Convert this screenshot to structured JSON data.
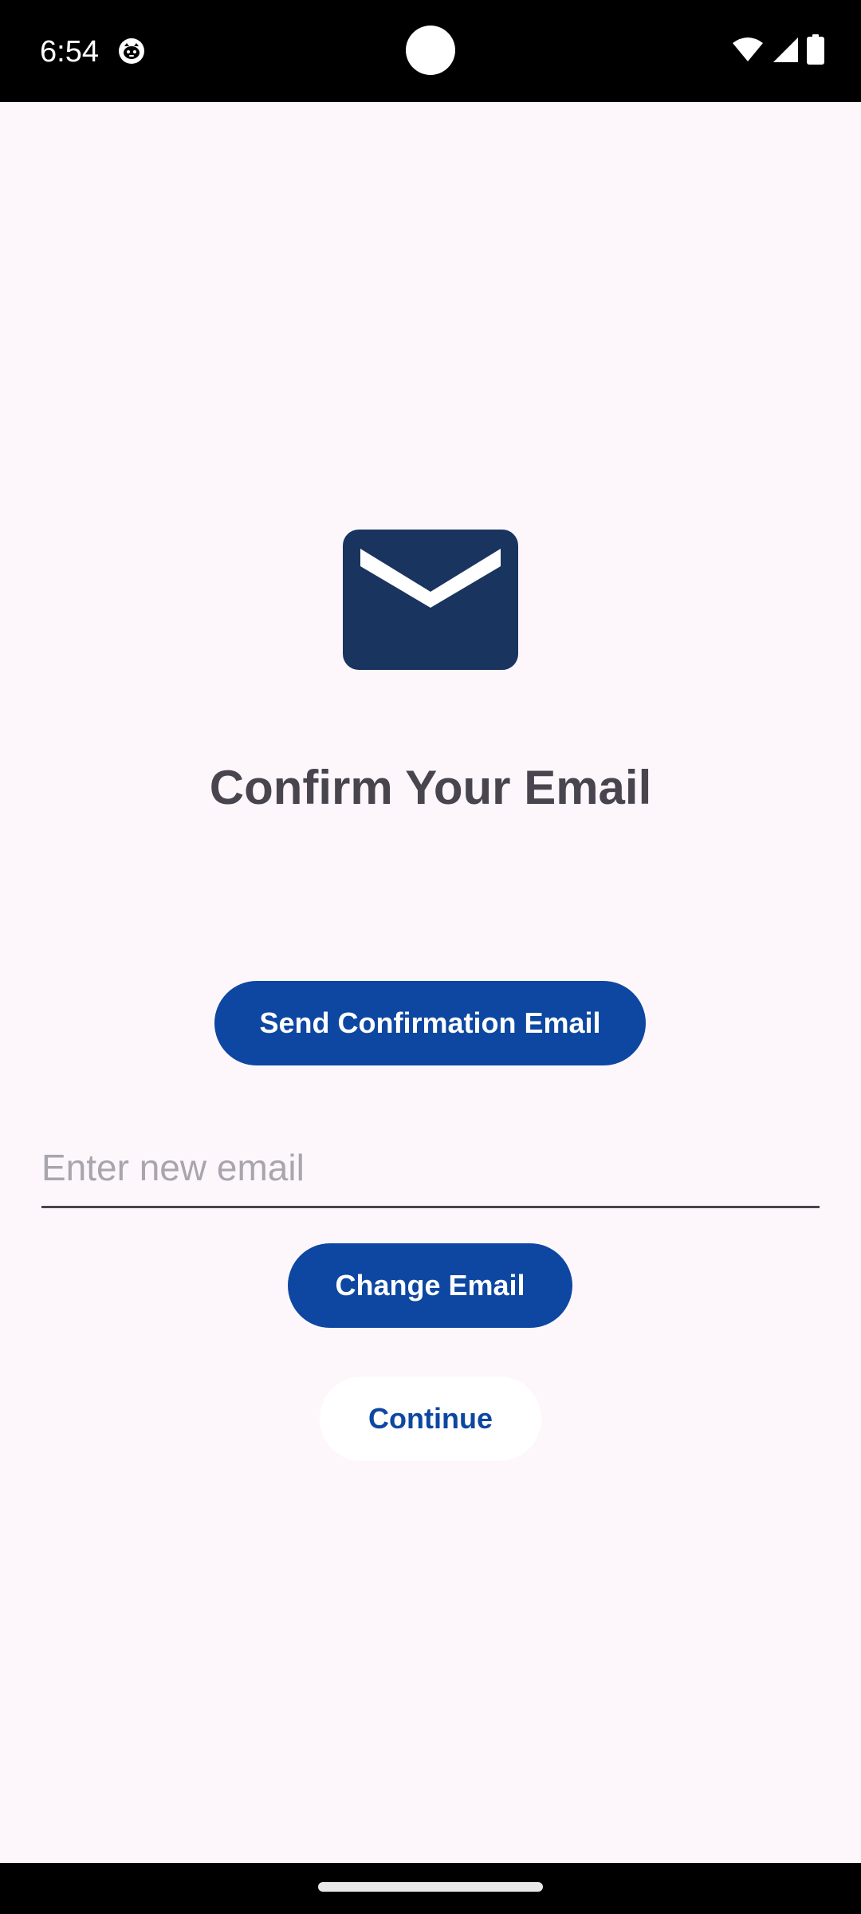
{
  "status_bar": {
    "time": "6:54",
    "app_icon": "cat-face-icon",
    "icons": [
      "wifi-icon",
      "cellular-signal-icon",
      "battery-icon"
    ]
  },
  "illustration": {
    "icon": "email-envelope-icon",
    "color": "#1a3460"
  },
  "main": {
    "title": "Confirm Your Email",
    "send_button_label": "Send Confirmation Email",
    "email_input": {
      "value": "",
      "placeholder": "Enter new email"
    },
    "change_button_label": "Change Email",
    "continue_button_label": "Continue"
  },
  "colors": {
    "primary": "#0d47a1",
    "background": "#fdf7fc",
    "title_text": "#48454e",
    "placeholder": "#a9a5ad"
  }
}
